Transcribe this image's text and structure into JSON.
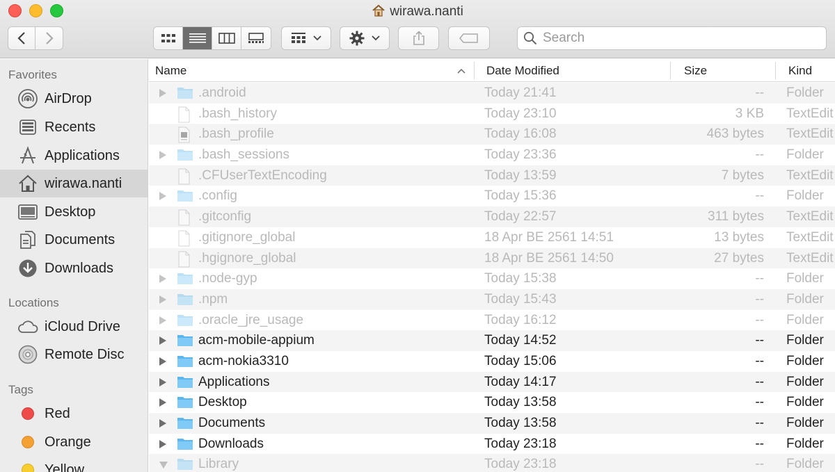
{
  "window": {
    "title": "wirawa.nanti"
  },
  "toolbar": {
    "search_placeholder": "Search",
    "view_modes": [
      "icon-view",
      "list-view",
      "column-view",
      "gallery-view"
    ],
    "active_view": "list-view"
  },
  "sidebar": {
    "favorites_heading": "Favorites",
    "favorites": [
      {
        "label": "AirDrop",
        "icon": "airdrop-icon"
      },
      {
        "label": "Recents",
        "icon": "recents-icon"
      },
      {
        "label": "Applications",
        "icon": "applications-icon"
      },
      {
        "label": "wirawa.nanti",
        "icon": "home-icon",
        "selected": true
      },
      {
        "label": "Desktop",
        "icon": "desktop-icon"
      },
      {
        "label": "Documents",
        "icon": "documents-icon"
      },
      {
        "label": "Downloads",
        "icon": "downloads-icon"
      }
    ],
    "locations_heading": "Locations",
    "locations": [
      {
        "label": "iCloud Drive",
        "icon": "icloud-icon"
      },
      {
        "label": "Remote Disc",
        "icon": "disc-icon"
      }
    ],
    "tags_heading": "Tags",
    "tags": [
      {
        "label": "Red",
        "color": "#f04b4b"
      },
      {
        "label": "Orange",
        "color": "#f5a033"
      },
      {
        "label": "Yellow",
        "color": "#f7cd2f"
      }
    ]
  },
  "list": {
    "columns": {
      "name": "Name",
      "date": "Date Modified",
      "size": "Size",
      "kind": "Kind"
    },
    "files": [
      {
        "name": ".android",
        "date": "Today 21:41",
        "size": "--",
        "kind": "Folder",
        "type": "folder",
        "hidden": true
      },
      {
        "name": ".bash_history",
        "date": "Today 23:10",
        "size": "3 KB",
        "kind": "TextEdit",
        "type": "document",
        "hidden": true
      },
      {
        "name": ".bash_profile",
        "date": "Today 16:08",
        "size": "463 bytes",
        "kind": "TextEdit",
        "type": "shell",
        "hidden": true
      },
      {
        "name": ".bash_sessions",
        "date": "Today 23:36",
        "size": "--",
        "kind": "Folder",
        "type": "folder",
        "hidden": true
      },
      {
        "name": ".CFUserTextEncoding",
        "date": "Today 13:59",
        "size": "7 bytes",
        "kind": "TextEdit",
        "type": "document",
        "hidden": true
      },
      {
        "name": ".config",
        "date": "Today 15:36",
        "size": "--",
        "kind": "Folder",
        "type": "folder",
        "hidden": true
      },
      {
        "name": ".gitconfig",
        "date": "Today 22:57",
        "size": "311 bytes",
        "kind": "TextEdit",
        "type": "document",
        "hidden": true
      },
      {
        "name": ".gitignore_global",
        "date": "18 Apr BE 2561 14:51",
        "size": "13 bytes",
        "kind": "TextEdit",
        "type": "document",
        "hidden": true
      },
      {
        "name": ".hgignore_global",
        "date": "18 Apr BE 2561 14:50",
        "size": "27 bytes",
        "kind": "TextEdit",
        "type": "document",
        "hidden": true
      },
      {
        "name": ".node-gyp",
        "date": "Today 15:38",
        "size": "--",
        "kind": "Folder",
        "type": "folder",
        "hidden": true
      },
      {
        "name": ".npm",
        "date": "Today 15:43",
        "size": "--",
        "kind": "Folder",
        "type": "folder",
        "hidden": true
      },
      {
        "name": ".oracle_jre_usage",
        "date": "Today 16:12",
        "size": "--",
        "kind": "Folder",
        "type": "folder",
        "hidden": true
      },
      {
        "name": "acm-mobile-appium",
        "date": "Today 14:52",
        "size": "--",
        "kind": "Folder",
        "type": "folder",
        "hidden": false
      },
      {
        "name": "acm-nokia3310",
        "date": "Today 15:06",
        "size": "--",
        "kind": "Folder",
        "type": "folder",
        "hidden": false
      },
      {
        "name": "Applications",
        "date": "Today 14:17",
        "size": "--",
        "kind": "Folder",
        "type": "folder",
        "hidden": false
      },
      {
        "name": "Desktop",
        "date": "Today 13:58",
        "size": "--",
        "kind": "Folder",
        "type": "folder",
        "hidden": false
      },
      {
        "name": "Documents",
        "date": "Today 13:58",
        "size": "--",
        "kind": "Folder",
        "type": "folder",
        "hidden": false
      },
      {
        "name": "Downloads",
        "date": "Today 23:18",
        "size": "--",
        "kind": "Folder",
        "type": "folder",
        "hidden": false
      },
      {
        "name": "Library",
        "date": "Today 23:18",
        "size": "--",
        "kind": "Folder",
        "type": "folder",
        "hidden": true,
        "expanded": true
      }
    ]
  }
}
